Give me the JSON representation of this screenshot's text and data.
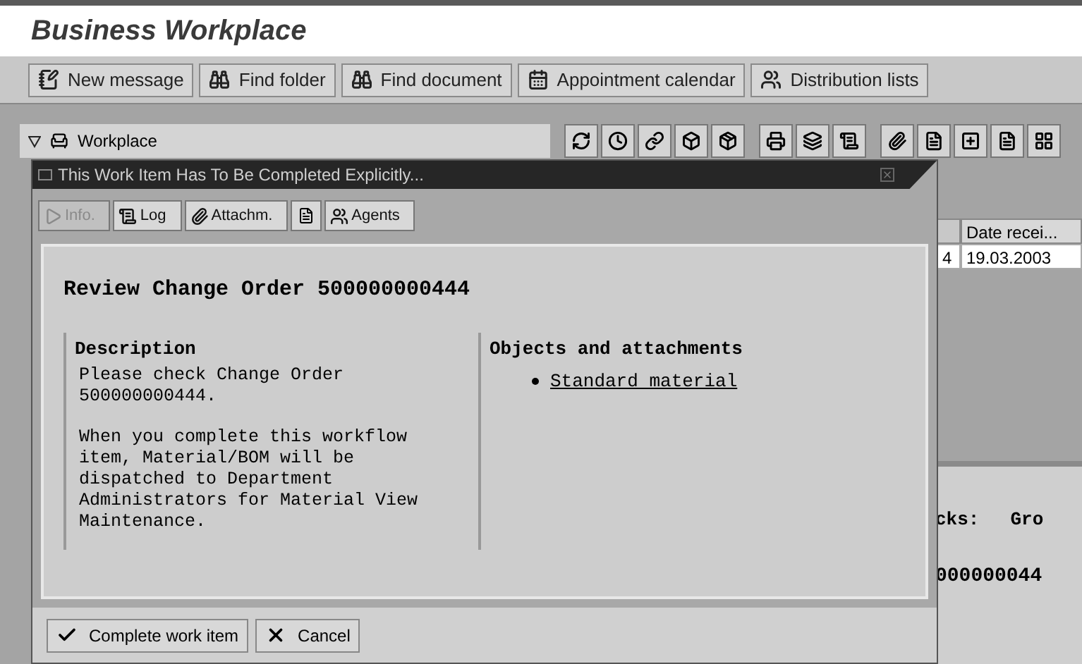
{
  "title": "Business Workplace",
  "toolbar": [
    {
      "label": "New message"
    },
    {
      "label": "Find folder"
    },
    {
      "label": "Find document"
    },
    {
      "label": "Appointment calendar"
    },
    {
      "label": "Distribution lists"
    }
  ],
  "tree": {
    "label": "Workplace",
    "expanded": true
  },
  "table": {
    "columns": [
      {
        "label": "Date recei..."
      }
    ],
    "rows": [
      {
        "column_1": "4",
        "date": "19.03.2003"
      }
    ]
  },
  "lower_panel": {
    "label_1": "cks:",
    "label_2": "Gro",
    "value": "000000044"
  },
  "dialog": {
    "title": "This Work Item Has To Be Completed Explicitly...",
    "tabs": [
      {
        "label": "Info.",
        "selected": true
      },
      {
        "label": "Log",
        "selected": false
      },
      {
        "label": "Attachm.",
        "selected": false
      },
      {
        "label": "Agents",
        "selected": false
      }
    ],
    "heading": "Review Change Order 500000000444",
    "description": {
      "heading": "Description",
      "paragraphs": [
        "Please check Change Order 500000000444.",
        "When you complete this workflow item, Material/BOM will be dispatched to Department Administrators for Material View Maintenance."
      ]
    },
    "objects": {
      "heading": "Objects and attachments",
      "links": [
        "Standard material"
      ]
    },
    "buttons": [
      {
        "label": "Complete work item"
      },
      {
        "label": "Cancel"
      }
    ]
  }
}
